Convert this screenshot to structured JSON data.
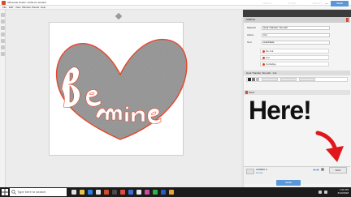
{
  "app": {
    "title": "Silhouette Studio: Untitled-1.studio3",
    "menu": [
      "File",
      "Edit",
      "View",
      "Window",
      "Panels",
      "Help"
    ],
    "window_controls": [
      "—",
      "☐",
      "✕"
    ]
  },
  "tabs": [
    {
      "label": "DESIGN",
      "active": false
    },
    {
      "label": "STORE",
      "active": false
    },
    {
      "label": "LIBRARY",
      "active": false
    },
    {
      "label": "SEND",
      "active": true
    }
  ],
  "panel": {
    "header": "SIMPLE",
    "rows": [
      {
        "label": "Material",
        "value": "Heat Transfer, Smooth"
      },
      {
        "label": "Action",
        "value": "Cut"
      },
      {
        "label": "Tool",
        "value": "Autoblade"
      }
    ],
    "materials": [
      "No Cut",
      "Cut",
      "Cut Edge"
    ],
    "section_title": "Heat Transfer, Smooth - Cut",
    "send_section": "Send"
  },
  "annotation": {
    "text": "Here!"
  },
  "machine": {
    "name": "CAMEO 3",
    "status": "Ready",
    "send_label": "SEND",
    "test_label": "TEST"
  },
  "taskbar": {
    "search_placeholder": "Type here to search",
    "time": "1:51 PM",
    "date": "6/10/2018"
  },
  "colors": {
    "accent_blue": "#5a97d8",
    "brand_red": "#d24b2a",
    "heart_fill": "#9b9b9b",
    "cut_line": "#e8452c",
    "arrow_red": "#e0181b"
  },
  "icons": {
    "start": "windows-logo-icon",
    "search": "search-icon",
    "connection": "usb-connection-icon"
  }
}
